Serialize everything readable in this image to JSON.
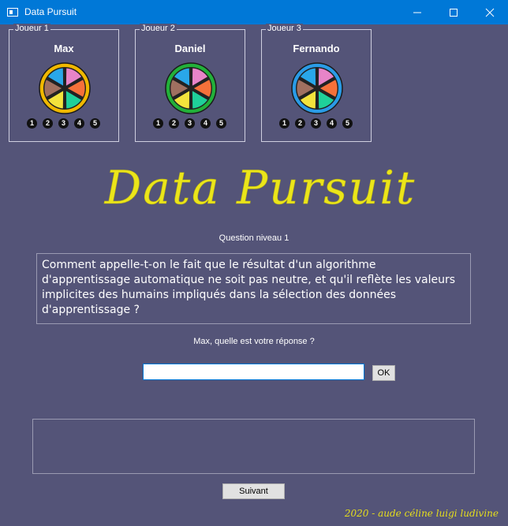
{
  "window": {
    "title": "Data Pursuit",
    "controls": [
      "minimize",
      "maximize",
      "close"
    ]
  },
  "players": [
    {
      "legend": "Joueur 1",
      "name": "Max",
      "ring_color": "#f0b800",
      "levels": [
        "1",
        "2",
        "3",
        "4",
        "5"
      ]
    },
    {
      "legend": "Joueur 2",
      "name": "Daniel",
      "ring_color": "#22b03a",
      "levels": [
        "1",
        "2",
        "3",
        "4",
        "5"
      ]
    },
    {
      "legend": "Joueur 3",
      "name": "Fernando",
      "ring_color": "#2a9be6",
      "levels": [
        "1",
        "2",
        "3",
        "4",
        "5"
      ]
    }
  ],
  "wedge_colors": [
    "#e884c8",
    "#f6713a",
    "#1fd09a",
    "#f3e33c",
    "#a07060",
    "#29a7e9"
  ],
  "logo_text": "Data Pursuit",
  "question": {
    "level_label": "Question niveau 1",
    "text": "Comment appelle-t-on le fait que le résultat d'un algorithme d'apprentissage automatique ne soit pas neutre, et qu'il reflète les valeurs implicites des humains impliqués dans la sélection des données d'apprentissage ?"
  },
  "answer": {
    "prompt": "Max, quelle est votre réponse ?",
    "value": "",
    "ok_label": "OK"
  },
  "feedback_text": "",
  "next_label": "Suivant",
  "credits": "2020 - aude céline luigi ludivine",
  "colors": {
    "background": "#545478",
    "logo": "#ebe51a",
    "titlebar": "#0078d7"
  }
}
